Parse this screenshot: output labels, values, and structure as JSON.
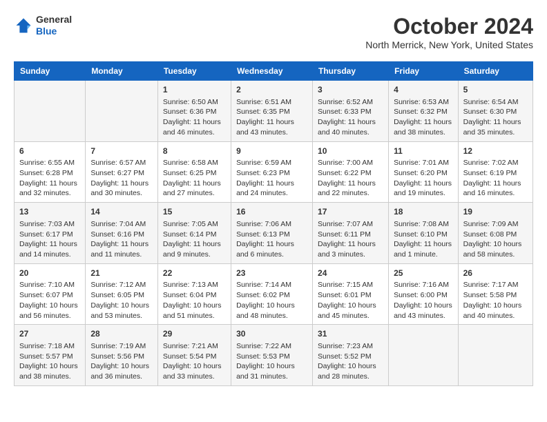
{
  "header": {
    "logo_line1": "General",
    "logo_line2": "Blue",
    "title": "October 2024",
    "subtitle": "North Merrick, New York, United States"
  },
  "calendar": {
    "days_of_week": [
      "Sunday",
      "Monday",
      "Tuesday",
      "Wednesday",
      "Thursday",
      "Friday",
      "Saturday"
    ],
    "weeks": [
      {
        "cells": [
          {
            "day": "",
            "content": ""
          },
          {
            "day": "",
            "content": ""
          },
          {
            "day": "1",
            "content": "Sunrise: 6:50 AM\nSunset: 6:36 PM\nDaylight: 11 hours and 46 minutes."
          },
          {
            "day": "2",
            "content": "Sunrise: 6:51 AM\nSunset: 6:35 PM\nDaylight: 11 hours and 43 minutes."
          },
          {
            "day": "3",
            "content": "Sunrise: 6:52 AM\nSunset: 6:33 PM\nDaylight: 11 hours and 40 minutes."
          },
          {
            "day": "4",
            "content": "Sunrise: 6:53 AM\nSunset: 6:32 PM\nDaylight: 11 hours and 38 minutes."
          },
          {
            "day": "5",
            "content": "Sunrise: 6:54 AM\nSunset: 6:30 PM\nDaylight: 11 hours and 35 minutes."
          }
        ]
      },
      {
        "cells": [
          {
            "day": "6",
            "content": "Sunrise: 6:55 AM\nSunset: 6:28 PM\nDaylight: 11 hours and 32 minutes."
          },
          {
            "day": "7",
            "content": "Sunrise: 6:57 AM\nSunset: 6:27 PM\nDaylight: 11 hours and 30 minutes."
          },
          {
            "day": "8",
            "content": "Sunrise: 6:58 AM\nSunset: 6:25 PM\nDaylight: 11 hours and 27 minutes."
          },
          {
            "day": "9",
            "content": "Sunrise: 6:59 AM\nSunset: 6:23 PM\nDaylight: 11 hours and 24 minutes."
          },
          {
            "day": "10",
            "content": "Sunrise: 7:00 AM\nSunset: 6:22 PM\nDaylight: 11 hours and 22 minutes."
          },
          {
            "day": "11",
            "content": "Sunrise: 7:01 AM\nSunset: 6:20 PM\nDaylight: 11 hours and 19 minutes."
          },
          {
            "day": "12",
            "content": "Sunrise: 7:02 AM\nSunset: 6:19 PM\nDaylight: 11 hours and 16 minutes."
          }
        ]
      },
      {
        "cells": [
          {
            "day": "13",
            "content": "Sunrise: 7:03 AM\nSunset: 6:17 PM\nDaylight: 11 hours and 14 minutes."
          },
          {
            "day": "14",
            "content": "Sunrise: 7:04 AM\nSunset: 6:16 PM\nDaylight: 11 hours and 11 minutes."
          },
          {
            "day": "15",
            "content": "Sunrise: 7:05 AM\nSunset: 6:14 PM\nDaylight: 11 hours and 9 minutes."
          },
          {
            "day": "16",
            "content": "Sunrise: 7:06 AM\nSunset: 6:13 PM\nDaylight: 11 hours and 6 minutes."
          },
          {
            "day": "17",
            "content": "Sunrise: 7:07 AM\nSunset: 6:11 PM\nDaylight: 11 hours and 3 minutes."
          },
          {
            "day": "18",
            "content": "Sunrise: 7:08 AM\nSunset: 6:10 PM\nDaylight: 11 hours and 1 minute."
          },
          {
            "day": "19",
            "content": "Sunrise: 7:09 AM\nSunset: 6:08 PM\nDaylight: 10 hours and 58 minutes."
          }
        ]
      },
      {
        "cells": [
          {
            "day": "20",
            "content": "Sunrise: 7:10 AM\nSunset: 6:07 PM\nDaylight: 10 hours and 56 minutes."
          },
          {
            "day": "21",
            "content": "Sunrise: 7:12 AM\nSunset: 6:05 PM\nDaylight: 10 hours and 53 minutes."
          },
          {
            "day": "22",
            "content": "Sunrise: 7:13 AM\nSunset: 6:04 PM\nDaylight: 10 hours and 51 minutes."
          },
          {
            "day": "23",
            "content": "Sunrise: 7:14 AM\nSunset: 6:02 PM\nDaylight: 10 hours and 48 minutes."
          },
          {
            "day": "24",
            "content": "Sunrise: 7:15 AM\nSunset: 6:01 PM\nDaylight: 10 hours and 45 minutes."
          },
          {
            "day": "25",
            "content": "Sunrise: 7:16 AM\nSunset: 6:00 PM\nDaylight: 10 hours and 43 minutes."
          },
          {
            "day": "26",
            "content": "Sunrise: 7:17 AM\nSunset: 5:58 PM\nDaylight: 10 hours and 40 minutes."
          }
        ]
      },
      {
        "cells": [
          {
            "day": "27",
            "content": "Sunrise: 7:18 AM\nSunset: 5:57 PM\nDaylight: 10 hours and 38 minutes."
          },
          {
            "day": "28",
            "content": "Sunrise: 7:19 AM\nSunset: 5:56 PM\nDaylight: 10 hours and 36 minutes."
          },
          {
            "day": "29",
            "content": "Sunrise: 7:21 AM\nSunset: 5:54 PM\nDaylight: 10 hours and 33 minutes."
          },
          {
            "day": "30",
            "content": "Sunrise: 7:22 AM\nSunset: 5:53 PM\nDaylight: 10 hours and 31 minutes."
          },
          {
            "day": "31",
            "content": "Sunrise: 7:23 AM\nSunset: 5:52 PM\nDaylight: 10 hours and 28 minutes."
          },
          {
            "day": "",
            "content": ""
          },
          {
            "day": "",
            "content": ""
          }
        ]
      }
    ]
  }
}
